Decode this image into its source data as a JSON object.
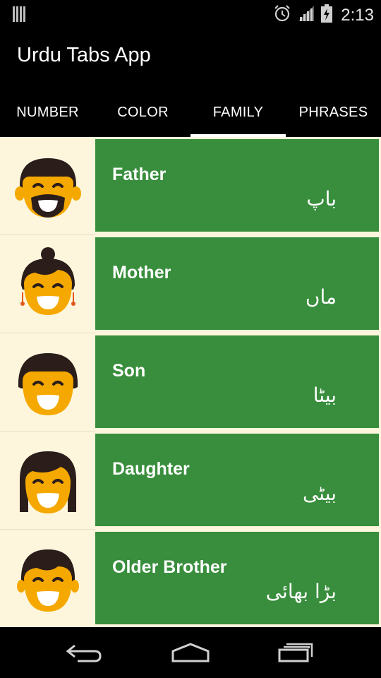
{
  "status_bar": {
    "time": "2:13",
    "icons": [
      "notification-icon",
      "alarm-icon",
      "signal-icon",
      "battery-charging-icon"
    ]
  },
  "app": {
    "title": "Urdu Tabs App"
  },
  "tabs": [
    {
      "label": "NUMBER",
      "active": false
    },
    {
      "label": "COLOR",
      "active": false
    },
    {
      "label": "FAMILY",
      "active": true
    },
    {
      "label": "PHRASES",
      "active": false
    }
  ],
  "items": [
    {
      "english": "Father",
      "urdu": "باپ",
      "icon": "father-face-icon"
    },
    {
      "english": "Mother",
      "urdu": "ماں",
      "icon": "mother-face-icon"
    },
    {
      "english": "Son",
      "urdu": "بیٹا",
      "icon": "son-face-icon"
    },
    {
      "english": "Daughter",
      "urdu": "بیٹی",
      "icon": "daughter-face-icon"
    },
    {
      "english": "Older Brother",
      "urdu": "بڑا بھائی",
      "icon": "older-brother-face-icon"
    }
  ],
  "nav_bar": {
    "icons": [
      "back-icon",
      "home-icon",
      "recent-apps-icon"
    ]
  },
  "colors": {
    "card_green": "#388e3c",
    "list_background": "#fdf6dc",
    "face_yellow": "#f5a800",
    "hair": "#2b1d1a"
  }
}
